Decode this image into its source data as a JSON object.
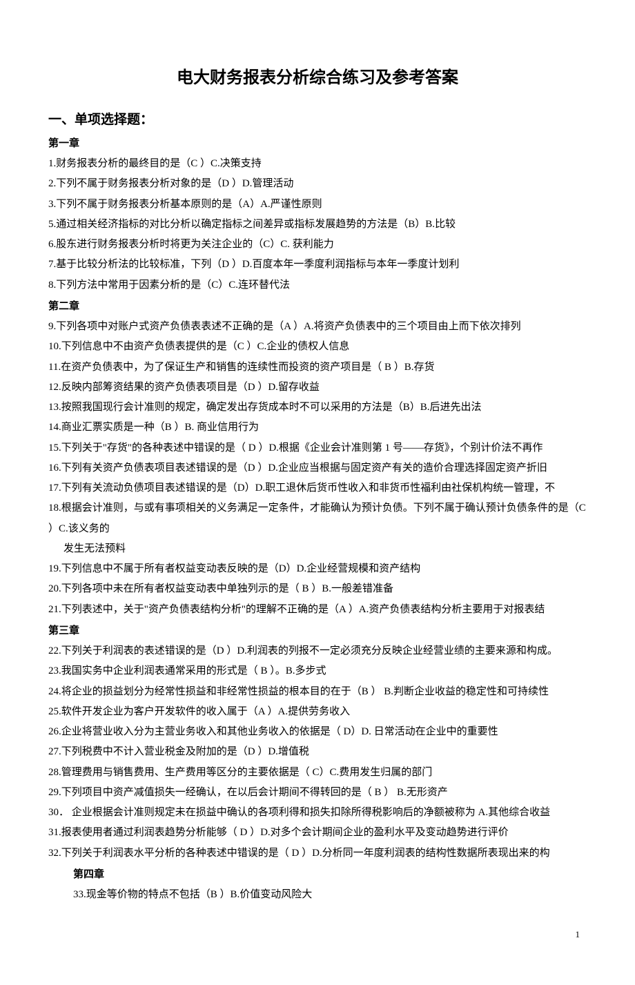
{
  "title": "电大财务报表分析综合练习及参考答案",
  "section1_heading": "一、单项选择题：",
  "chapter1": "第一章",
  "q1": "1.财务报表分析的最终目的是（C ）C.决策支持",
  "q2": "2.下列不属于财务报表分析对象的是（D  ）D.管理活动",
  "q3": "3.下列不属于财务报表分析基本原则的是（A）A.严谨性原则",
  "q5": "5.通过相关经济指标的对比分析以确定指标之间差异或指标发展趋势的方法是（B）B.比较",
  "q6": "6.股东进行财务报表分析时将更为关注企业的（C）C. 获利能力",
  "q7": "7.基于比较分析法的比较标准，下列（D ）D.百度本年一季度利润指标与本年一季度计划利",
  "q8": "8.下列方法中常用于因素分析的是（C）C.连环替代法",
  "chapter2": "第二章",
  "q9": "9.下列各项中对账户式资产负债表表述不正确的是（A ）A.将资产负债表中的三个项目由上而下依次排列",
  "q10": "10.下列信息中不由资产负债表提供的是（C ）C.企业的债权人信息",
  "q11": "11.在资产负债表中，为了保证生产和销售的连续性而投资的资产项目是（ B ）B.存货",
  "q12": "12.反映内部筹资结果的资产负债表项目是（D ）D.留存收益",
  "q13": "13.按照我国现行会计准则的规定，确定发出存货成本时不可以采用的方法是（B）B.后进先出法",
  "q14": "14.商业汇票实质是一种（B ）B. 商业信用行为",
  "q15": "15.下列关于\"存货\"的各种表述中错误的是（ D ）D.根据《企业会计准则第 1 号——存货》，个别计价法不再作",
  "q16": "16.下列有关资产负债表项目表述错误的是（D ）D.企业应当根据与固定资产有关的造价合理选择固定资产折旧",
  "q17": "17.下列有关流动负债项目表述错误的是（D）D.职工退休后货币性收入和非货币性福利由社保机构统一管理，不",
  "q18": "18.根据会计准则，与或有事项相关的义务满足一定条件，才能确认为预计负债。下列不属于确认预计负债条件的是（C ）C.该义务的",
  "q18b": "发生无法预料",
  "q19": "19.下列信息中不属于所有者权益变动表反映的是（D）D.企业经营规模和资产结构",
  "q20": "20.下列各项中未在所有者权益变动表中单独列示的是（ B ）B.一般差错准备",
  "q21": "21.下列表述中，关于\"资产负债表结构分析\"的理解不正确的是（A  ）A.资产负债表结构分析主要用于对报表结",
  "chapter3": "第三章",
  "q22": "22.下列关于利润表的表述错误的是（D  ）D.利润表的列报不一定必须充分反映企业经营业绩的主要来源和构成。",
  "q23": "23.我国实务中企业利润表通常采用的形式是（ B ）。B.多步式",
  "q24": "24.将企业的损益划分为经常性损益和非经常性损益的根本目的在于（B  ） B.判断企业收益的稳定性和可持续性",
  "q25": "25.软件开发企业为客户开发软件的收入属于（A  ）A.提供劳务收入",
  "q26": "26.企业将营业收入分为主营业务收入和其他业务收入的依据是（ D）D. 日常活动在企业中的重要性",
  "q27": "27.下列税费中不计入营业税金及附加的是（D ）D.增值税",
  "q28": "28.管理费用与销售费用、生产费用等区分的主要依据是（ C）C.费用发生归属的部门",
  "q29": "29.下列项目中资产减值损失一经确认，在以后会计期间不得转回的是（ B ）  B.无形资产",
  "q30": "30． 企业根据会计准则规定未在损益中确认的各项利得和损失扣除所得税影响后的净额被称为 A.其他综合收益",
  "q31": "31.报表使用者通过利润表趋势分析能够（ D ）D.对多个会计期间企业的盈利水平及变动趋势进行评价",
  "q32": "32.下列关于利润表水平分析的各种表述中错误的是（ D ）D.分析同一年度利润表的结构性数据所表现出来的构",
  "chapter4": "第四章",
  "q33": "33.现金等价物的特点不包括（B  ）B.价值变动风险大",
  "page_num": "1"
}
